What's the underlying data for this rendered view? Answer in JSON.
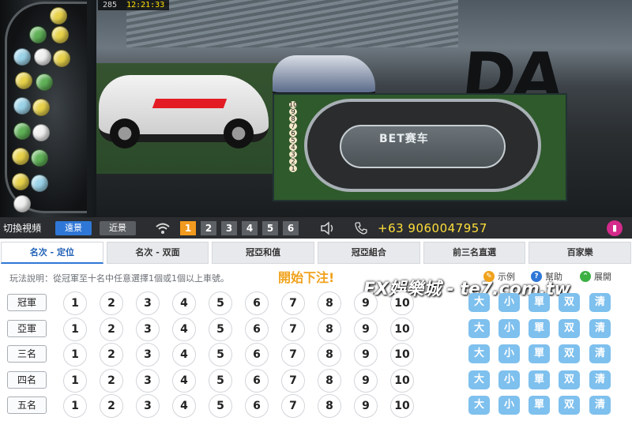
{
  "video": {
    "frame_id": "285",
    "clock": "12:21:33",
    "track_logo": "BET赛车",
    "backdrop_letters": "DA",
    "lane_numbers": [
      "10",
      "9",
      "8",
      "7",
      "6",
      "5",
      "4",
      "3",
      "2",
      "1"
    ]
  },
  "controls": {
    "switch_label": "切換視頻",
    "far_label": "遠景",
    "near_label": "近景",
    "cameras": [
      "1",
      "2",
      "3",
      "4",
      "5",
      "6"
    ],
    "active_camera": "1",
    "phone": "+63 9060047957"
  },
  "tabs": [
    {
      "label": "名次 - 定位",
      "active": true
    },
    {
      "label": "名次 - 双面",
      "active": false
    },
    {
      "label": "冠亞和值",
      "active": false
    },
    {
      "label": "冠亞組合",
      "active": false
    },
    {
      "label": "前三名直選",
      "active": false
    },
    {
      "label": "百家樂",
      "active": false
    }
  ],
  "info": {
    "rule_text": "玩法說明：從冠軍至十名中任意選擇1個或1個以上車號。",
    "start_bet": "開始下注!",
    "watermark": "EX娛樂城 - te7.com.tw",
    "example_label": "示例",
    "help_label": "幫助",
    "expand_label": "展開"
  },
  "grid": {
    "rows": [
      "冠軍",
      "亞軍",
      "三名",
      "四名",
      "五名"
    ],
    "numbers": [
      "1",
      "2",
      "3",
      "4",
      "5",
      "6",
      "7",
      "8",
      "9",
      "10"
    ],
    "quick_picks": [
      "大",
      "小",
      "單",
      "双",
      "清"
    ]
  },
  "colors": {
    "accent": "#2f77d6",
    "camera_active": "#f29a1f",
    "phone": "#ffdf3b",
    "start_bet": "#f0a21b",
    "quick_pick": "#7ec0ee"
  }
}
